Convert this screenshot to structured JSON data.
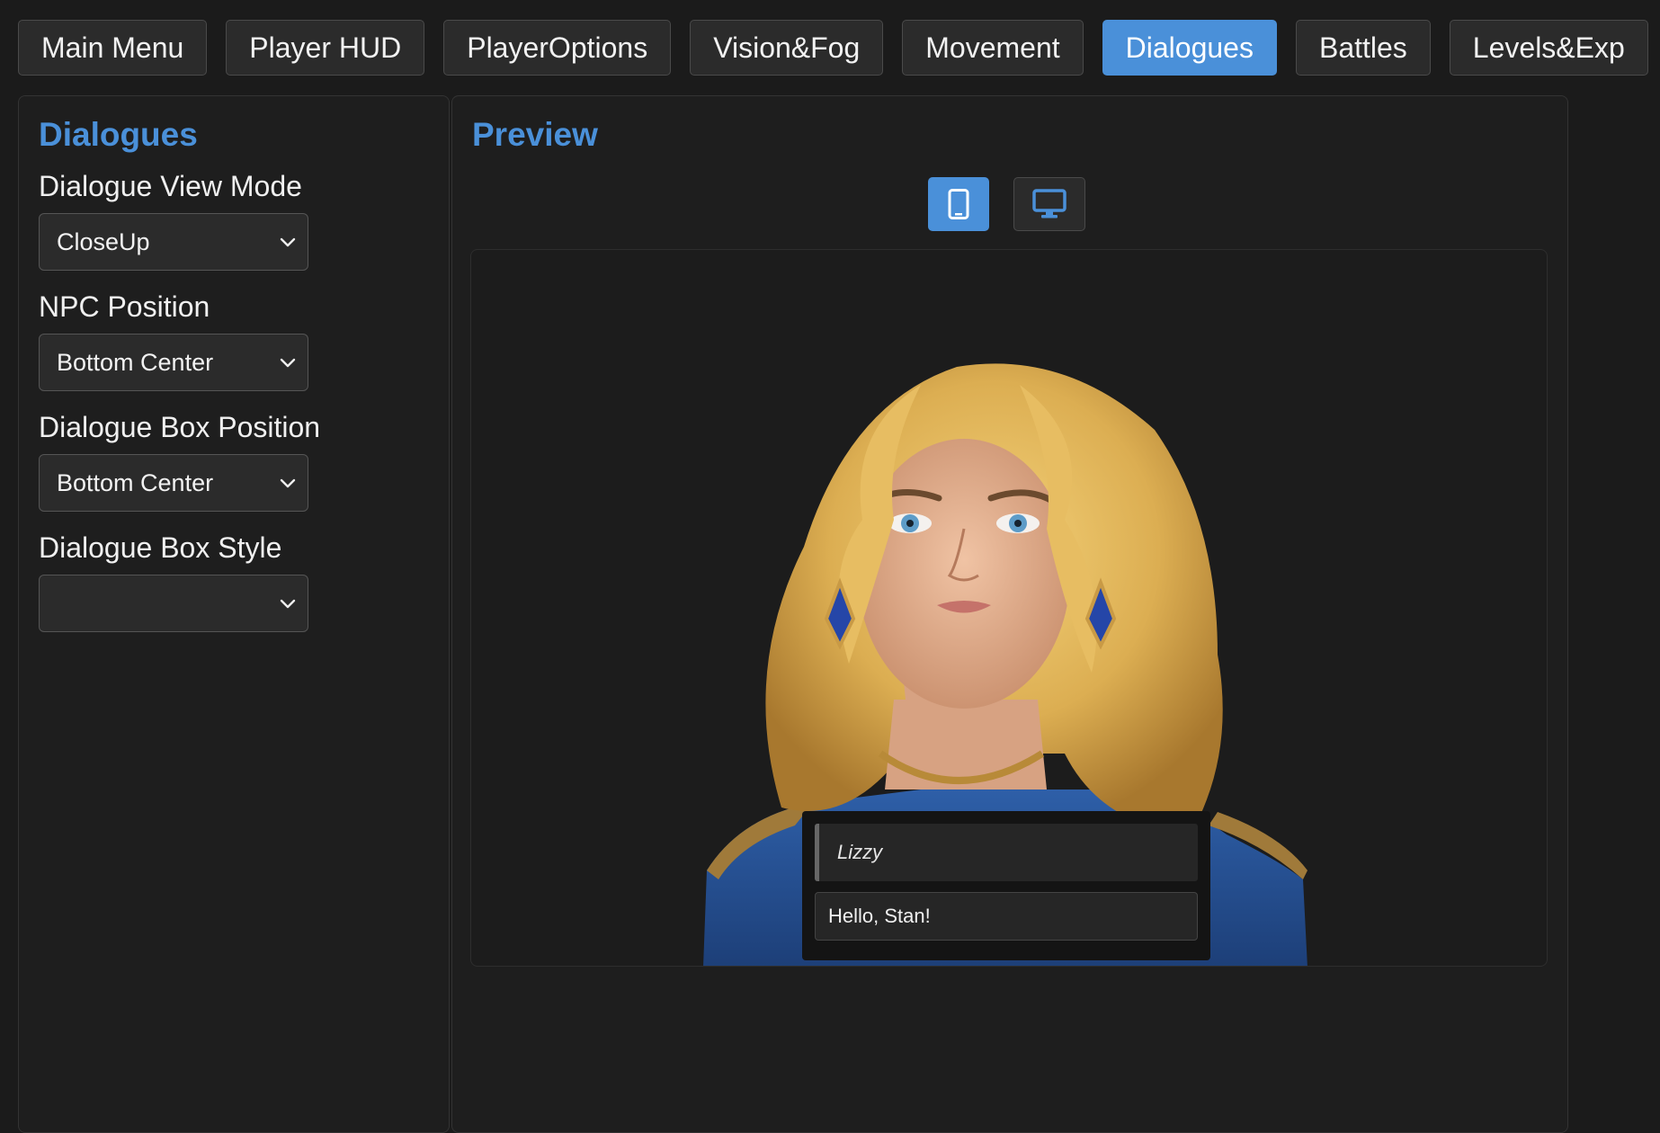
{
  "tabs": [
    {
      "label": "Main Menu"
    },
    {
      "label": "Player HUD"
    },
    {
      "label": "PlayerOptions"
    },
    {
      "label": "Vision&Fog"
    },
    {
      "label": "Movement"
    },
    {
      "label": "Dialogues",
      "active": true
    },
    {
      "label": "Battles"
    },
    {
      "label": "Levels&Exp"
    }
  ],
  "settings": {
    "title": "Dialogues",
    "view_mode": {
      "label": "Dialogue View Mode",
      "value": "CloseUp"
    },
    "npc_position": {
      "label": "NPC Position",
      "value": "Bottom Center"
    },
    "box_position": {
      "label": "Dialogue Box Position",
      "value": "Bottom Center"
    },
    "box_style": {
      "label": "Dialogue Box Style",
      "value": ""
    }
  },
  "preview": {
    "title": "Preview",
    "device_buttons": [
      {
        "icon": "mobile-icon",
        "active": true
      },
      {
        "icon": "desktop-icon",
        "active": false
      }
    ],
    "dialogue": {
      "speaker": "Lizzy",
      "text": "Hello, Stan!"
    }
  },
  "colors": {
    "accent": "#4a90d9",
    "background": "#1b1b1b",
    "panel": "#1e1e1e",
    "control": "#2b2b2b"
  }
}
